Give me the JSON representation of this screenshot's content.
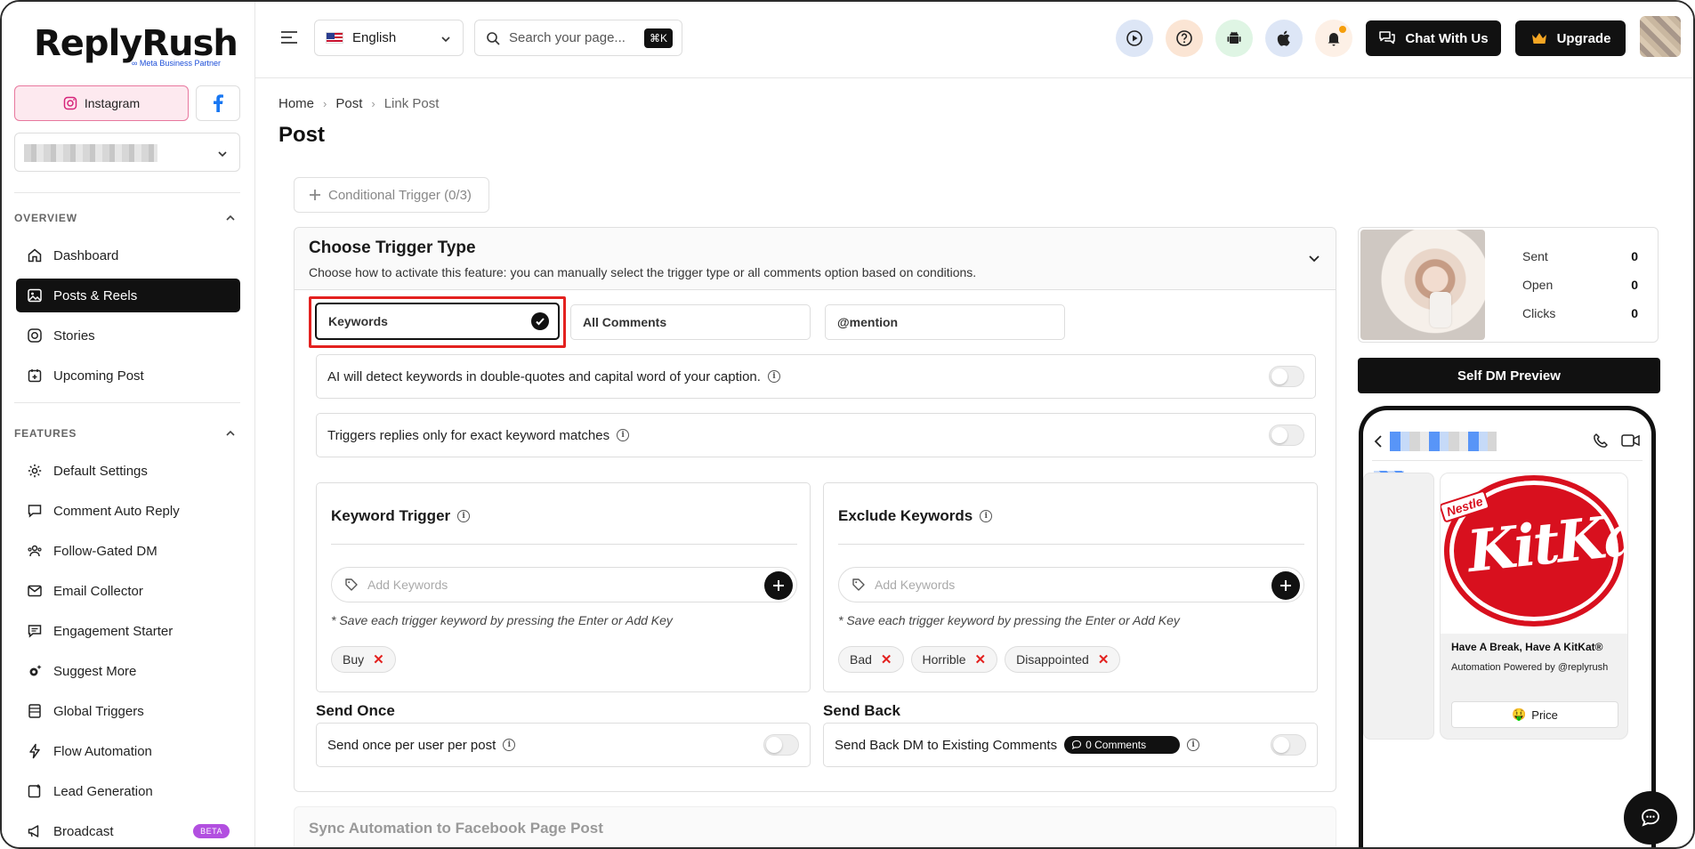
{
  "brand": {
    "name": "ReplyRush",
    "partner_text": "Meta Business Partner"
  },
  "platform_tabs": {
    "instagram": "Instagram"
  },
  "sidebar": {
    "overview_label": "OVERVIEW",
    "overview_items": [
      {
        "label": "Dashboard"
      },
      {
        "label": "Posts & Reels"
      },
      {
        "label": "Stories"
      },
      {
        "label": "Upcoming Post"
      }
    ],
    "features_label": "FEATURES",
    "feature_items": [
      {
        "label": "Default Settings"
      },
      {
        "label": "Comment Auto Reply"
      },
      {
        "label": "Follow-Gated DM"
      },
      {
        "label": "Email Collector"
      },
      {
        "label": "Engagement Starter"
      },
      {
        "label": "Suggest More"
      },
      {
        "label": "Global Triggers"
      },
      {
        "label": "Flow Automation"
      },
      {
        "label": "Lead Generation"
      },
      {
        "label": "Broadcast",
        "badge": "BETA"
      }
    ]
  },
  "header": {
    "language": "English",
    "search_placeholder": "Search your page...",
    "shortcut": "⌘K",
    "chat_label": "Chat With Us",
    "upgrade_label": "Upgrade"
  },
  "breadcrumb": {
    "home": "Home",
    "post": "Post",
    "current": "Link Post"
  },
  "page_title": "Post",
  "conditional_trigger": "Conditional Trigger (0/3)",
  "trigger": {
    "title": "Choose Trigger Type",
    "description": "Choose how to activate this feature: you can manually select the trigger type or all comments option based on conditions.",
    "options": {
      "keywords": "Keywords",
      "all_comments": "All Comments",
      "mention": "@mention"
    },
    "ai_detect": "AI will detect keywords in double-quotes and capital word of your caption.",
    "exact_match": "Triggers replies only for exact keyword matches"
  },
  "keyword_trigger": {
    "title": "Keyword Trigger",
    "placeholder": "Add Keywords",
    "hint": "* Save each trigger keyword by pressing the Enter or Add Key",
    "chips": [
      "Buy"
    ]
  },
  "exclude_keywords": {
    "title": "Exclude Keywords",
    "placeholder": "Add Keywords",
    "hint": "* Save each trigger keyword by pressing the Enter or Add Key",
    "chips": [
      "Bad",
      "Horrible",
      "Disappointed"
    ]
  },
  "send_once": {
    "title": "Send Once",
    "label": "Send once per user per post"
  },
  "send_back": {
    "title": "Send Back",
    "label": "Send Back DM to Existing Comments",
    "pill": "0 Comments"
  },
  "sync": {
    "title": "Sync Automation to Facebook Page Post"
  },
  "stats": {
    "sent_label": "Sent",
    "sent_value": "0",
    "open_label": "Open",
    "open_value": "0",
    "clicks_label": "Clicks",
    "clicks_value": "0"
  },
  "preview_button": "Self DM Preview",
  "dm_preview": {
    "card_title": "Have A Break, Have A KitKat®",
    "card_body": "Automation Powered by @replyrush",
    "price_button": "Price",
    "brand_image_text": "KitKat",
    "brand_tag": "Nestle"
  },
  "colors": {
    "accent": "#111111",
    "highlight": "#e3211f",
    "instagram_tab_bg": "#fde9ef",
    "beta_badge": "#b24fe0"
  }
}
